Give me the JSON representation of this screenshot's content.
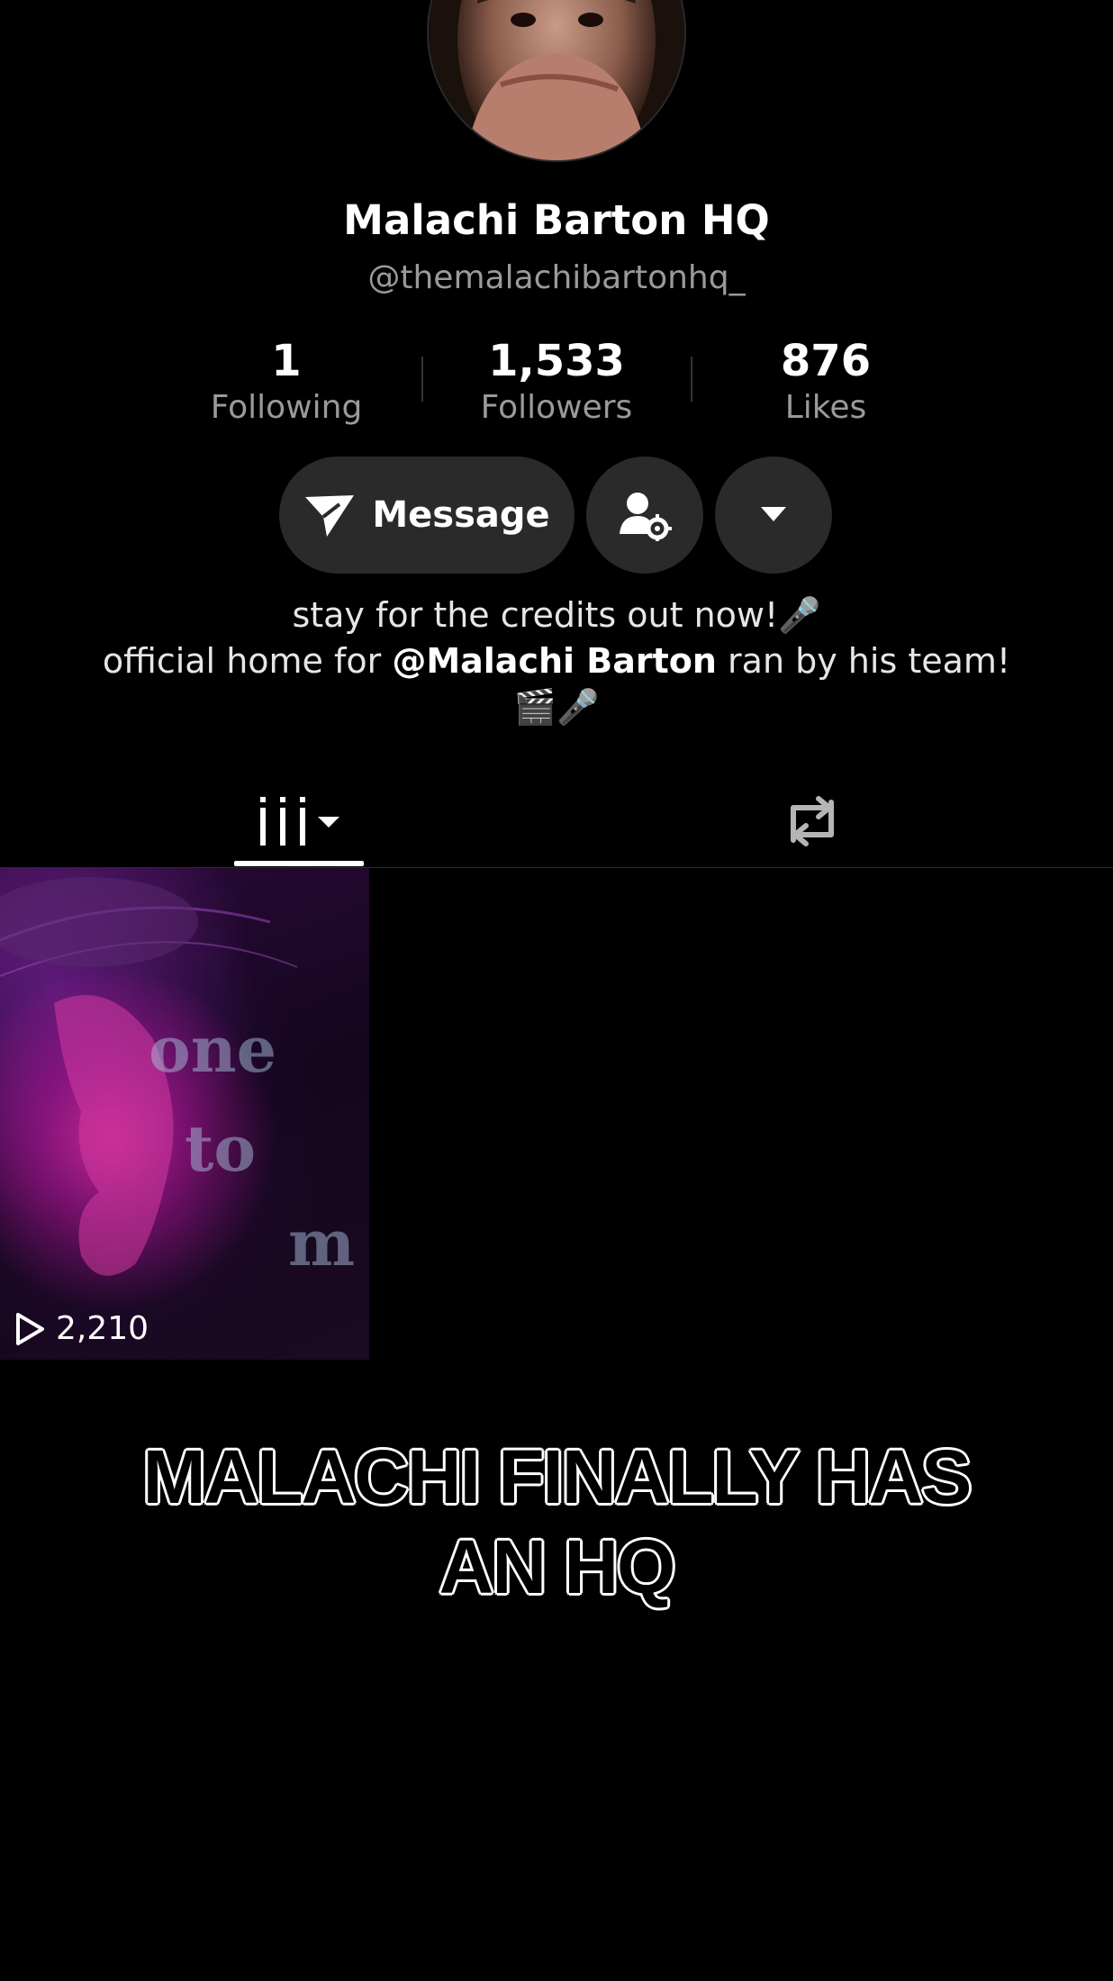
{
  "profile": {
    "display_name": "Malachi Barton HQ",
    "handle": "@themalachibartonhq_"
  },
  "stats": [
    {
      "value": "1",
      "label": "Following"
    },
    {
      "value": "1,533",
      "label": "Followers"
    },
    {
      "value": "876",
      "label": "Likes"
    }
  ],
  "actions": {
    "message_label": "Message",
    "message_icon": "paper-plane-icon",
    "manage_icon": "person-gear-icon",
    "more_icon": "caret-down-icon"
  },
  "bio": {
    "line1": "stay for the credits out now!🎤",
    "line2_before": "official home for ",
    "line2_mention": "@Malachi Barton",
    "line2_after": " ran by his team!",
    "line3": "🎬🎤"
  },
  "tabs": {
    "videos_icon": "grid-bars-icon",
    "reposts_icon": "repost-icon"
  },
  "videos": [
    {
      "views": "2,210",
      "overlay_words": [
        "one",
        "to",
        "m"
      ]
    }
  ],
  "caption": {
    "line1": "MALACHI FINALLY HAS",
    "line2": "AN HQ"
  },
  "colors": {
    "background": "#000000",
    "button_bg": "#2a2a2a",
    "secondary_text": "#9a9a9a"
  }
}
